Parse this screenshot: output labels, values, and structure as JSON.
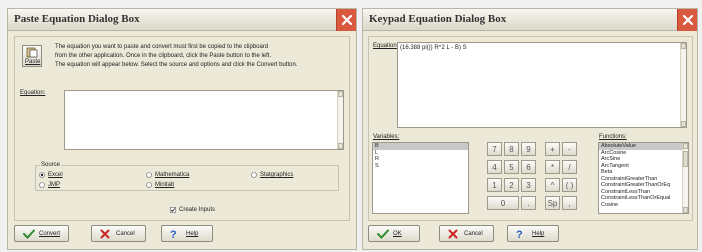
{
  "paste_dialog": {
    "title": "Paste Equation Dialog Box",
    "paste_button_label": "Paste",
    "instructions": [
      "The equation you want to paste and convert must first be copied to the clipboard",
      "from the other application.  Once in the clipboard, click the Paste button to the  left.",
      "The equation will appear below.  Select the source and options and click the Convert button."
    ],
    "equation_label": "Equation:",
    "equation_value": "",
    "source_label": "Source",
    "sources": [
      "Excel",
      "JMP",
      "Mathematica",
      "Minitab",
      "Statgraphics"
    ],
    "selected_source": "Excel",
    "create_inputs_label": "Create Inputs",
    "create_inputs_checked": true,
    "buttons": {
      "convert": "Convert",
      "cancel": "Cancel",
      "help": "Help"
    }
  },
  "keypad_dialog": {
    "title": "Keypad Equation Dialog Box",
    "equation_label": "Equation:",
    "equation_value": "(16.388 pi()) R^2 L - B) S",
    "variables_label": "Variables:",
    "variables": [
      "B",
      "L",
      "R",
      "S"
    ],
    "selected_variable": "B",
    "keys": [
      "7",
      "8",
      "9",
      "+",
      "-",
      "4",
      "5",
      "6",
      "*",
      "/",
      "1",
      "2",
      "3",
      "^",
      "( )",
      "0",
      ".",
      "Sp",
      ","
    ],
    "functions_label": "Functions:",
    "functions": [
      "AbsoluteValue",
      "ArcCosine",
      "ArcSine",
      "ArcTangent",
      "Beta",
      "ConstraintGreaterThan",
      "ConstraintGreaterThanOrEq",
      "ConstraintLessThan",
      "ConstraintLessThanOrEqual",
      "Cosine"
    ],
    "selected_function": "AbsoluteValue",
    "buttons": {
      "ok": "OK",
      "cancel": "Cancel",
      "help": "Help"
    }
  },
  "colors": {
    "title_text": "#333333",
    "close_button": "#d9593f",
    "check_green": "#2e8b2e",
    "cancel_red": "#cc2222",
    "help_blue": "#2a5fc0"
  },
  "icons": [
    "close-icon",
    "paste-icon",
    "checkmark-icon",
    "x-icon",
    "help-icon"
  ]
}
